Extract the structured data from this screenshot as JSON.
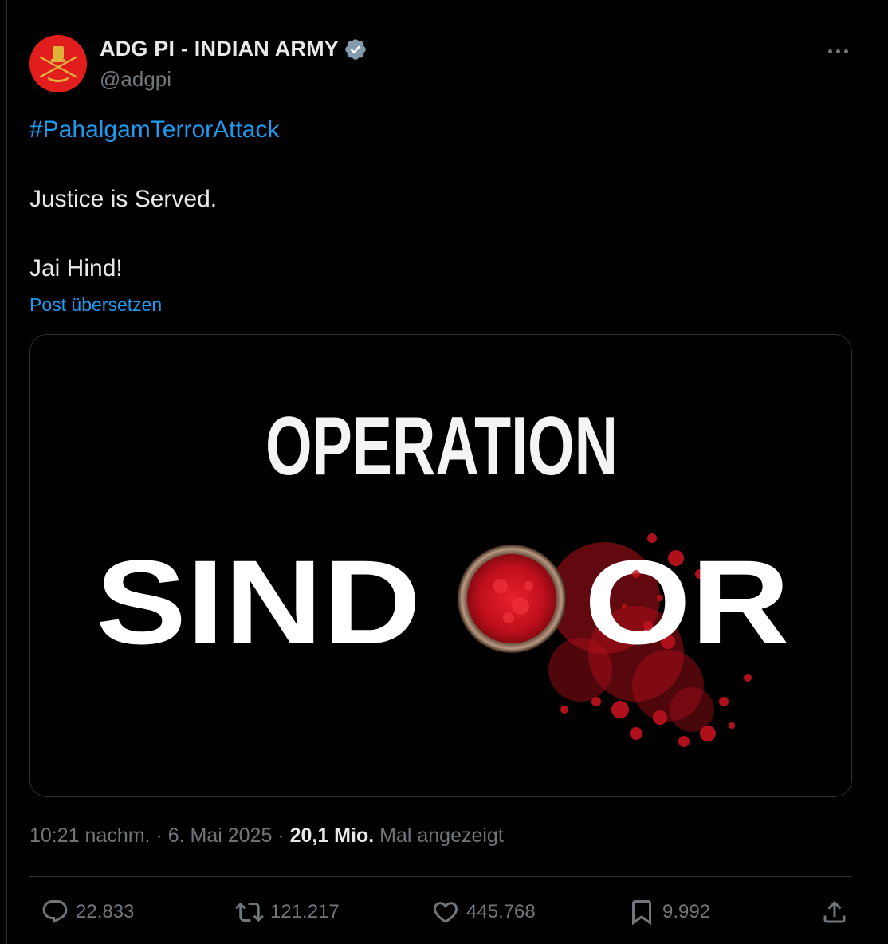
{
  "author": {
    "name": "ADG PI - INDIAN ARMY",
    "handle": "@adgpi",
    "verified_icon": "verified-badge-icon"
  },
  "post": {
    "hashtag": "#PahalgamTerrorAttack",
    "line1": "Justice is Served.",
    "line2": "Jai Hind!",
    "translate_label": "Post übersetzen"
  },
  "media": {
    "title_top": "OPERATION",
    "title_left": "SIND",
    "title_right": "OR"
  },
  "meta": {
    "time": "10:21 nachm.",
    "sep": " · ",
    "date": "6. Mai 2025",
    "views_count": "20,1 Mio.",
    "views_label": "Mal angezeigt"
  },
  "actions": {
    "replies": "22.833",
    "reposts": "121.217",
    "likes": "445.768",
    "bookmarks": "9.992"
  },
  "colors": {
    "accent": "#1d9bf0",
    "text": "#e7e9ea",
    "muted": "#71767b",
    "sindoor_red": "#d8121f"
  }
}
